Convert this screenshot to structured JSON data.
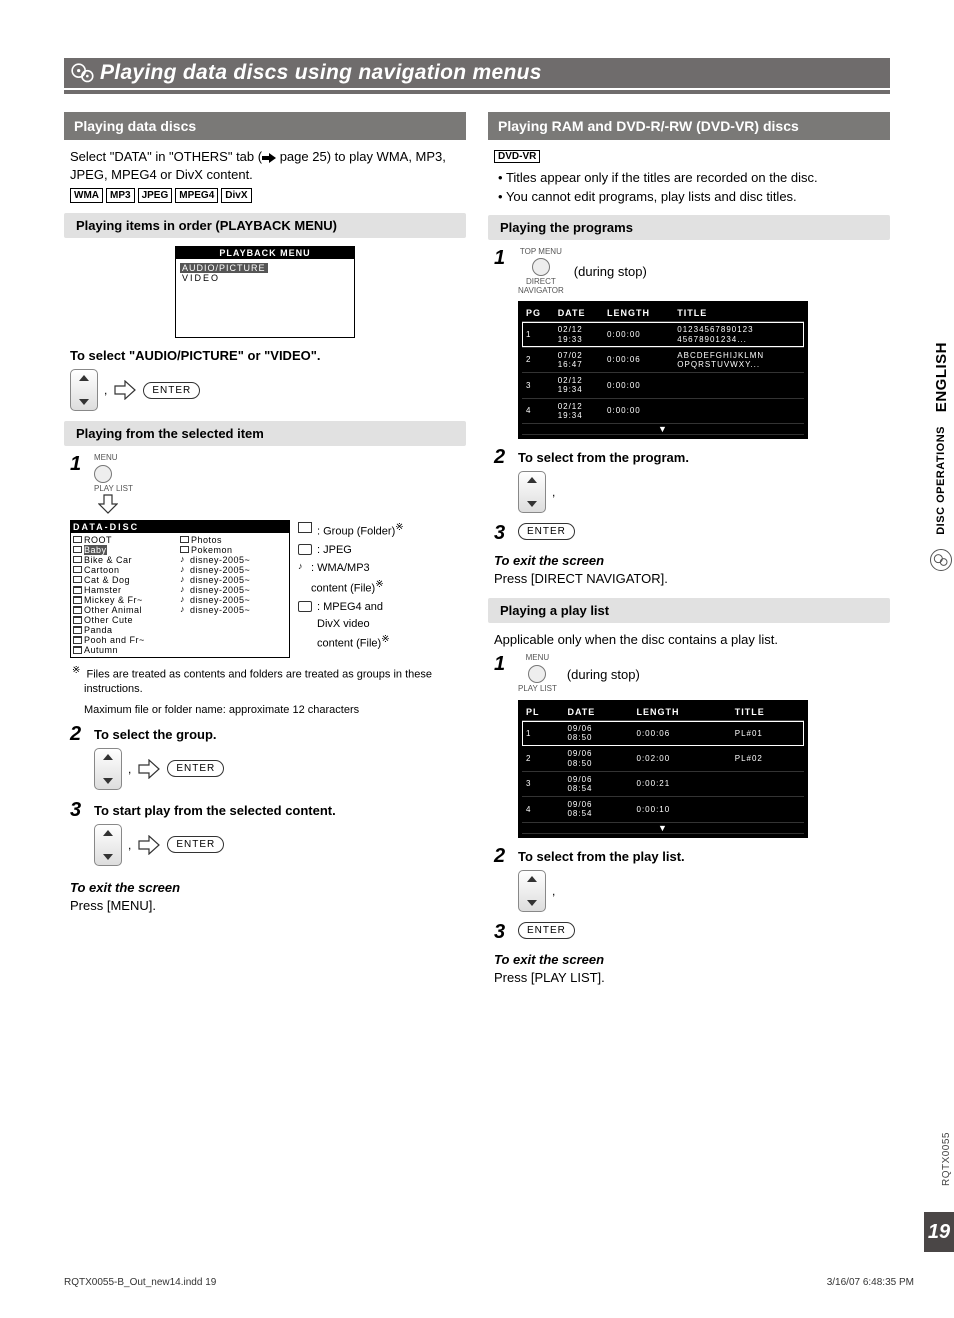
{
  "title": "Playing data discs using navigation menus",
  "left": {
    "header": "Playing data discs",
    "intro_a": "Select \"DATA\" in \"OTHERS\" tab  (",
    "intro_b": " page 25) to play WMA, MP3, JPEG, MPEG4 or DivX content.",
    "formats": [
      "WMA",
      "MP3",
      "JPEG",
      "MPEG4",
      "DivX"
    ],
    "sec1": "Playing items in order (PLAYBACK MENU)",
    "pb": {
      "title": "PLAYBACK MENU",
      "opt1": "AUDIO/PICTURE",
      "opt2": "VIDEO"
    },
    "select_instr": "To select \"AUDIO/PICTURE\" or \"VIDEO\".",
    "enter": "ENTER",
    "sec2": "Playing from the selected item",
    "remote1": {
      "top": "MENU",
      "bot": "PLAY LIST"
    },
    "tree": {
      "title": "DATA-DISC",
      "rootLabel": "ROOT",
      "colA": [
        "Baby",
        "Bike & Car",
        "Cartoon",
        "Cat & Dog",
        "Hamster",
        "Mickey & Fr~",
        "Other Animal",
        "Other Cute",
        "Panda",
        "Pooh and Fr~",
        "Autumn"
      ],
      "colB": [
        "Photos",
        "Pokemon",
        "disney-2005~",
        "disney-2005~",
        "disney-2005~",
        "disney-2005~",
        "disney-2005~",
        "disney-2005~"
      ]
    },
    "legend": {
      "l1": ": Group (Folder)",
      "l2": ": JPEG",
      "l3": ": WMA/MP3",
      "l3b": "content (File)",
      "l4": ": MPEG4 and",
      "l4b": "DivX video",
      "l4c": "content (File)"
    },
    "note": "Files are treated as contents and folders are treated as groups in these instructions.",
    "note2": "Maximum file or folder name: approximate 12 characters",
    "step2": "To select the group.",
    "step3": "To start play from the selected content.",
    "exit_h": "To exit the screen",
    "exit_b": "Press [MENU]."
  },
  "right": {
    "header": "Playing RAM and DVD-R/-RW (DVD-VR) discs",
    "dvdvr": "DVD-VR",
    "bul1": "Titles appear only if the titles are recorded on the disc.",
    "bul2": "You cannot edit programs, play lists and disc titles.",
    "sec1": "Playing the programs",
    "remote1": {
      "top": "TOP MENU",
      "bot1": "DIRECT",
      "bot2": "NAVIGATOR"
    },
    "during": "(during stop)",
    "tbl1": {
      "cols": [
        "PG",
        "DATE",
        "LENGTH",
        "TITLE"
      ],
      "rows": [
        {
          "n": "1",
          "d1": "02/12",
          "d2": "19:33",
          "len": "0:00:00",
          "t1": "01234567890123",
          "t2": "45678901234..."
        },
        {
          "n": "2",
          "d1": "07/02",
          "d2": "16:47",
          "len": "0:00:06",
          "t1": "ABCDEFGHIJKLMN",
          "t2": "OPQRSTUVWXY..."
        },
        {
          "n": "3",
          "d1": "02/12",
          "d2": "19:34",
          "len": "0:00:00",
          "t1": "",
          "t2": ""
        },
        {
          "n": "4",
          "d1": "02/12",
          "d2": "19:34",
          "len": "0:00:00",
          "t1": "",
          "t2": ""
        }
      ]
    },
    "step2": "To select from the program.",
    "exit1_h": "To exit the screen",
    "exit1_b": "Press [DIRECT NAVIGATOR].",
    "sec2": "Playing a play list",
    "pl_note": "Applicable only when the disc contains a play list.",
    "remote2": {
      "top": "MENU",
      "bot": "PLAY LIST"
    },
    "tbl2": {
      "cols": [
        "PL",
        "DATE",
        "LENGTH",
        "TITLE"
      ],
      "rows": [
        {
          "n": "1",
          "d1": "09/06",
          "d2": "08:50",
          "len": "0:00:06",
          "t": "PL#01"
        },
        {
          "n": "2",
          "d1": "09/06",
          "d2": "08:50",
          "len": "0:02:00",
          "t": "PL#02"
        },
        {
          "n": "3",
          "d1": "09/06",
          "d2": "08:54",
          "len": "0:00:21",
          "t": ""
        },
        {
          "n": "4",
          "d1": "09/06",
          "d2": "08:54",
          "len": "0:00:10",
          "t": ""
        }
      ]
    },
    "step2b": "To select from the play list.",
    "exit2_h": "To exit the screen",
    "exit2_b": "Press [PLAY LIST]."
  },
  "side": {
    "lang": "ENGLISH",
    "disc": "DISC OPERATIONS"
  },
  "page_no": "19",
  "doc_id": "RQTX0055",
  "footer": {
    "l": "RQTX0055-B_Out_new14.indd   19",
    "r": "3/16/07   6:48:35 PM"
  }
}
